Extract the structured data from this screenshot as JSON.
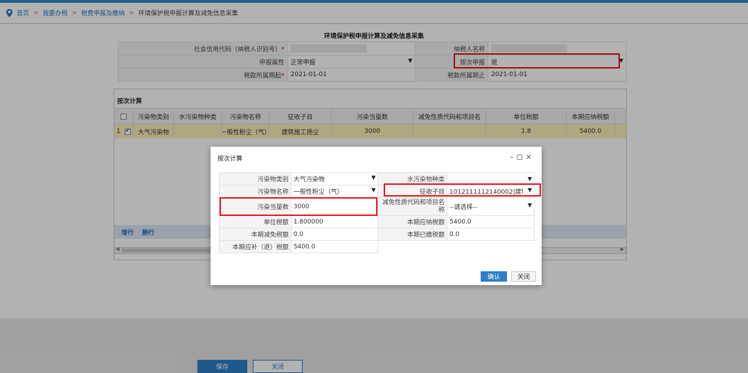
{
  "breadcrumb": {
    "items": [
      "首页",
      "我要办税",
      "税费申报及缴纳"
    ],
    "current": "环境保护税申报计算及减免信息采集",
    "sep": ">"
  },
  "form": {
    "title": "环境保护税申报计算及减免信息采集",
    "credit_code_label": "社会信用代码（纳税人识别号）",
    "taxpayer_name_label": "纳税人名称",
    "declare_attr_label": "申报属性",
    "declare_attr_value": "正常申报",
    "per_time_label": "按次申报",
    "per_time_value": "是",
    "period_start_label": "税款所属期起",
    "period_start_value": "2021-01-01",
    "period_end_label": "税款所属期止",
    "period_end_value": "2021-01-01",
    "required_mark": "*"
  },
  "grid": {
    "caption": "按次计算",
    "headers": [
      "污染物类别",
      "水污染物种类",
      "污染物名称",
      "征收子目",
      "污染当量数",
      "减免性质代码和项目名",
      "单位税额",
      "本期应纳税额"
    ],
    "row": {
      "index": "1",
      "cells": [
        "大气污染物",
        "",
        "一般性粉尘（气）",
        "建筑施工扬尘",
        "3000",
        "",
        "1.8",
        "5400.0"
      ]
    },
    "tools": [
      "增行",
      "删行"
    ]
  },
  "buttons": {
    "save": "保存",
    "close": "关闭"
  },
  "dialog": {
    "title": "按次计算",
    "controls": "–◻×",
    "fields": {
      "pollutant_cat_label": "污染物类别",
      "pollutant_cat_value": "大气污染物",
      "water_type_label": "水污染物种类",
      "water_type_value": "",
      "pollutant_name_label": "污染物名称",
      "pollutant_name_value": "一般性粉尘（气）",
      "sub_item_label": "征收子目",
      "sub_item_value": "1012111112140002|建筑",
      "equiv_label": "污染当量数",
      "equiv_value": "3000",
      "relief_label": "减免性质代码和项目名称",
      "relief_value": "--请选择--",
      "unit_tax_label": "单位税额",
      "unit_tax_value": "1.800000",
      "payable_label": "本期应纳税额",
      "payable_value": "5400.0",
      "relief_tax_label": "本期减免税额",
      "relief_tax_value": "0.0",
      "paid_label": "本期已缴税额",
      "paid_value": "0.0",
      "refund_label": "本期应补（退）税额",
      "refund_value": "5400.0"
    },
    "ok": "确认",
    "close": "关闭"
  },
  "icons": {
    "dropdown": "▼",
    "location": "location-pin-icon"
  },
  "colors": {
    "accent": "#2d7fc8",
    "highlight": "#e6141b",
    "selected_row": "#fbefb6"
  }
}
